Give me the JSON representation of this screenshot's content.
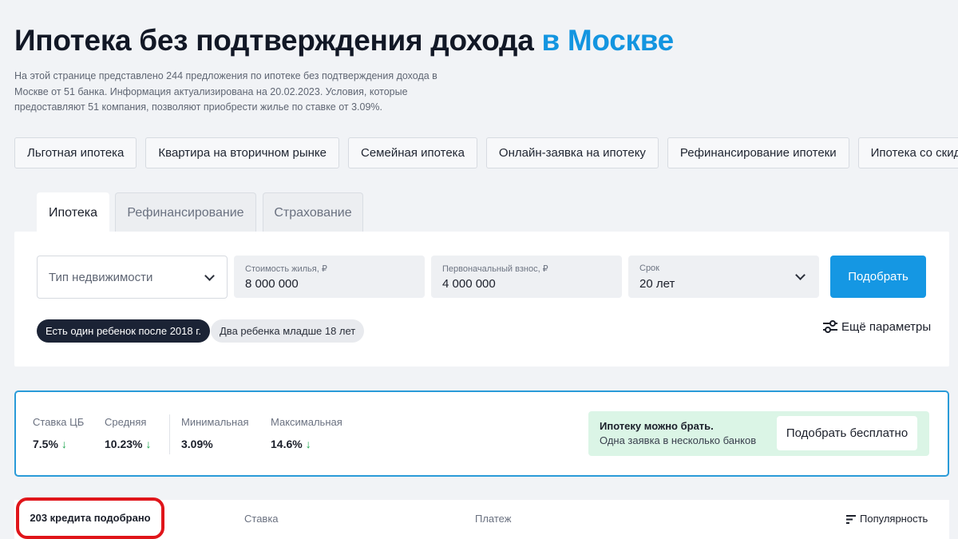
{
  "header": {
    "title": "Ипотека без подтверждения дохода",
    "title_accent": "в Москве",
    "lead": "На этой странице представлено 244 предложения по ипотеке без подтверждения дохода в Москве от 51 банка. Информация актуализирована на 20.02.2023. Условия, которые предоставляют 51 компания, позволяют приобрести жилье по ставке от 3.09%."
  },
  "chips": [
    "Льготная ипотека",
    "Квартира на вторичном рынке",
    "Семейная ипотека",
    "Онлайн-заявка на ипотеку",
    "Рефинансирование ипотеки",
    "Ипотека со скидкой"
  ],
  "tabs": [
    "Ипотека",
    "Рефинансирование",
    "Страхование"
  ],
  "form": {
    "property_type_placeholder": "Тип недвижимости",
    "cost_label": "Стоимость жилья, ₽",
    "cost_value": "8 000 000",
    "down_label": "Первоначальный взнос, ₽",
    "down_value": "4 000 000",
    "term_label": "Срок",
    "term_value": "20 лет",
    "submit_label": "Подобрать",
    "pill_active": "Есть один ребенок после 2018 г.",
    "pill_inactive": "Два ребенка младше 18 лет",
    "more_params": "Ещё параметры"
  },
  "rates": {
    "cb": {
      "label": "Ставка ЦБ",
      "value": "7.5%"
    },
    "avg": {
      "label": "Средняя",
      "value": "10.23%"
    },
    "min": {
      "label": "Минимальная",
      "value": "3.09%"
    },
    "max": {
      "label": "Максимальная",
      "value": "14.6%"
    },
    "arrow": "↓"
  },
  "promo": {
    "title": "Ипотеку можно брать.",
    "subtitle": "Одна заявка в несколько банков",
    "button": "Подобрать бесплатно"
  },
  "results": {
    "count": "203 кредита подобрано",
    "col_rate": "Ставка",
    "col_payment": "Платеж",
    "sort": "Популярность"
  },
  "colors": {
    "accent": "#1395e0",
    "button": "#1597e3",
    "highlight_border": "#2a9bd8",
    "promo_bg": "#dbf5e6",
    "annotation_red": "#e0151a"
  }
}
